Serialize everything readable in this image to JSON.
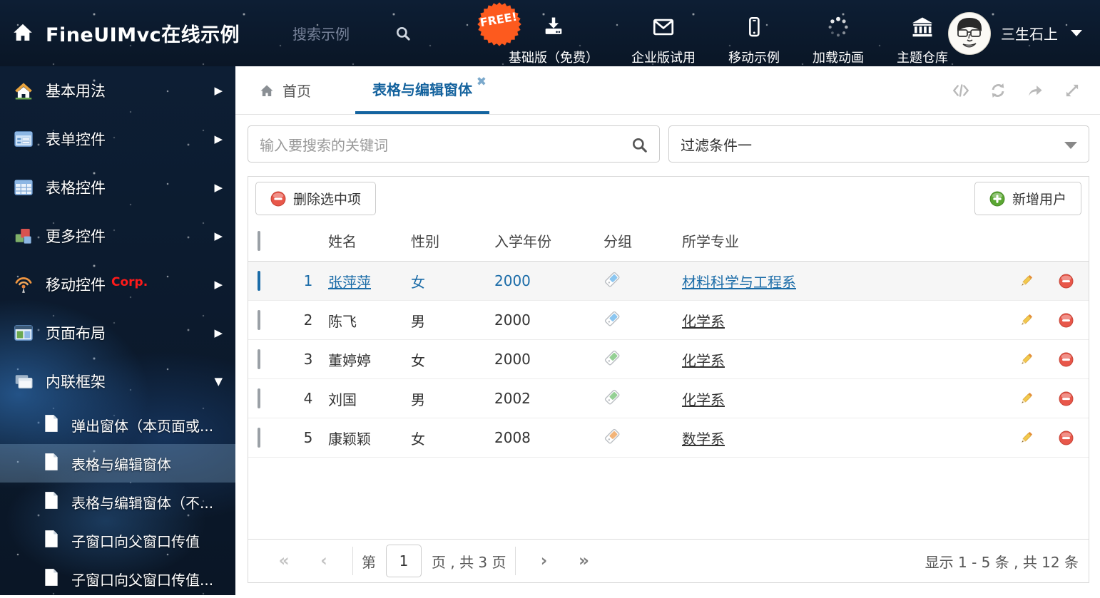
{
  "colors": {
    "accent": "#15639e",
    "row_selected": "#1b6ca8",
    "badge_orange": "#fd5a1e",
    "delete_red": "#e8574a",
    "add_green": "#5ba733"
  },
  "header": {
    "title": "FineUIMvc在线示例",
    "search_placeholder": "搜索示例",
    "free_badge": "FREE!",
    "nav": [
      {
        "label": "基础版（免费）",
        "icon": "download-icon"
      },
      {
        "label": "企业版试用",
        "icon": "envelope-icon"
      },
      {
        "label": "移动示例",
        "icon": "phone-icon"
      },
      {
        "label": "加载动画",
        "icon": "spinner-icon"
      },
      {
        "label": "主题仓库",
        "icon": "bank-icon"
      }
    ],
    "user": {
      "name": "三生石上"
    }
  },
  "sidebar": {
    "items": [
      {
        "label": "基本用法",
        "icon": "home-icon"
      },
      {
        "label": "表单控件",
        "icon": "form-icon"
      },
      {
        "label": "表格控件",
        "icon": "table-icon"
      },
      {
        "label": "更多控件",
        "icon": "cubes-icon"
      },
      {
        "label": "移动控件",
        "badge": "Corp.",
        "icon": "wireless-icon"
      },
      {
        "label": "页面布局",
        "icon": "layout-icon"
      },
      {
        "label": "内联框架",
        "icon": "frames-icon"
      }
    ],
    "subitems": [
      {
        "label": "弹出窗体（本页面或..."
      },
      {
        "label": "表格与编辑窗体"
      },
      {
        "label": "表格与编辑窗体（不..."
      },
      {
        "label": "子窗口向父窗口传值"
      },
      {
        "label": "子窗口向父窗口传值..."
      }
    ]
  },
  "tabs": {
    "home": "首页",
    "active": "表格与编辑窗体"
  },
  "filters": {
    "search_placeholder": "输入要搜索的关键词",
    "filter_value": "过滤条件一"
  },
  "toolbar": {
    "delete_label": "删除选中项",
    "add_label": "新增用户"
  },
  "table": {
    "columns": [
      "姓名",
      "性别",
      "入学年份",
      "分组",
      "所学专业"
    ],
    "rows": [
      {
        "index": "1",
        "name": "张萍萍",
        "gender": "女",
        "year": "2000",
        "tag_color": "#8bc6f0",
        "major": "材料科学与工程系"
      },
      {
        "index": "2",
        "name": "陈飞",
        "gender": "男",
        "year": "2000",
        "tag_color": "#8bc6f0",
        "major": "化学系"
      },
      {
        "index": "3",
        "name": "董婷婷",
        "gender": "女",
        "year": "2000",
        "tag_color": "#95d095",
        "major": "化学系"
      },
      {
        "index": "4",
        "name": "刘国",
        "gender": "男",
        "year": "2002",
        "tag_color": "#95d095",
        "major": "化学系"
      },
      {
        "index": "5",
        "name": "康颖颖",
        "gender": "女",
        "year": "2008",
        "tag_color": "#f2b479",
        "major": "数学系"
      }
    ]
  },
  "pagination": {
    "prefix": "第",
    "page": "1",
    "suffix": "页 , 共 3 页",
    "summary": "显示 1 - 5 条 , 共 12 条"
  }
}
